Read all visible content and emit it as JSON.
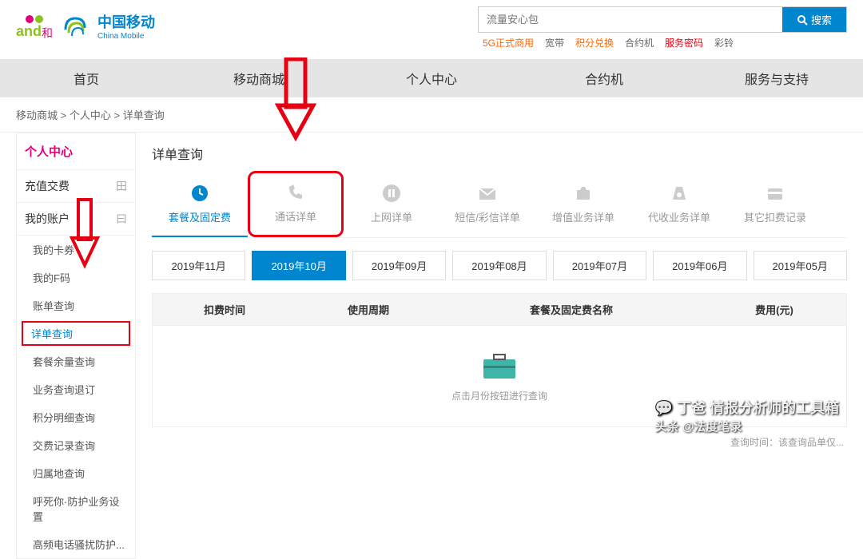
{
  "logo": {
    "and": "and",
    "he": "和",
    "cm_cn": "中国移动",
    "cm_en": "China Mobile"
  },
  "search": {
    "placeholder": "流量安心包",
    "button": "搜索"
  },
  "quick_links": [
    "5G正式商用",
    "宽带",
    "积分兑换",
    "合约机",
    "服务密码",
    "彩铃"
  ],
  "nav": [
    "首页",
    "移动商城",
    "个人中心",
    "合约机",
    "服务与支持"
  ],
  "breadcrumb": [
    "移动商城",
    "个人中心",
    "详单查询"
  ],
  "sidebar": {
    "title": "个人中心",
    "groups": [
      {
        "label": "充值交费",
        "icon": "plus"
      },
      {
        "label": "我的账户",
        "icon": "minus",
        "items": [
          "我的卡券",
          "我的F码",
          "账单查询",
          "详单查询",
          "套餐余量查询",
          "业务查询退订",
          "积分明细查询",
          "交费记录查询",
          "归属地查询",
          "呼死你·防护业务设置",
          "高频电话骚扰防护..."
        ]
      }
    ],
    "active_item": "详单查询"
  },
  "content": {
    "title": "详单查询",
    "tabs": [
      "套餐及固定费",
      "通话详单",
      "上网详单",
      "短信/彩信详单",
      "增值业务详单",
      "代收业务详单",
      "其它扣费记录"
    ],
    "active_tab": 0,
    "highlight_tab": 1,
    "months": [
      "2019年11月",
      "2019年10月",
      "2019年09月",
      "2019年08月",
      "2019年07月",
      "2019年06月",
      "2019年05月"
    ],
    "active_month": 1,
    "table_headers": [
      "扣费时间",
      "使用周期",
      "套餐及固定费名称",
      "费用(元)"
    ],
    "empty_hint": "点击月份按钮进行查询",
    "footer_note": "查询时间：该查询品单仅..."
  },
  "watermark": {
    "line1": "丁爸 情报分析师的工具箱",
    "line2": "头条 @法度笔录"
  }
}
